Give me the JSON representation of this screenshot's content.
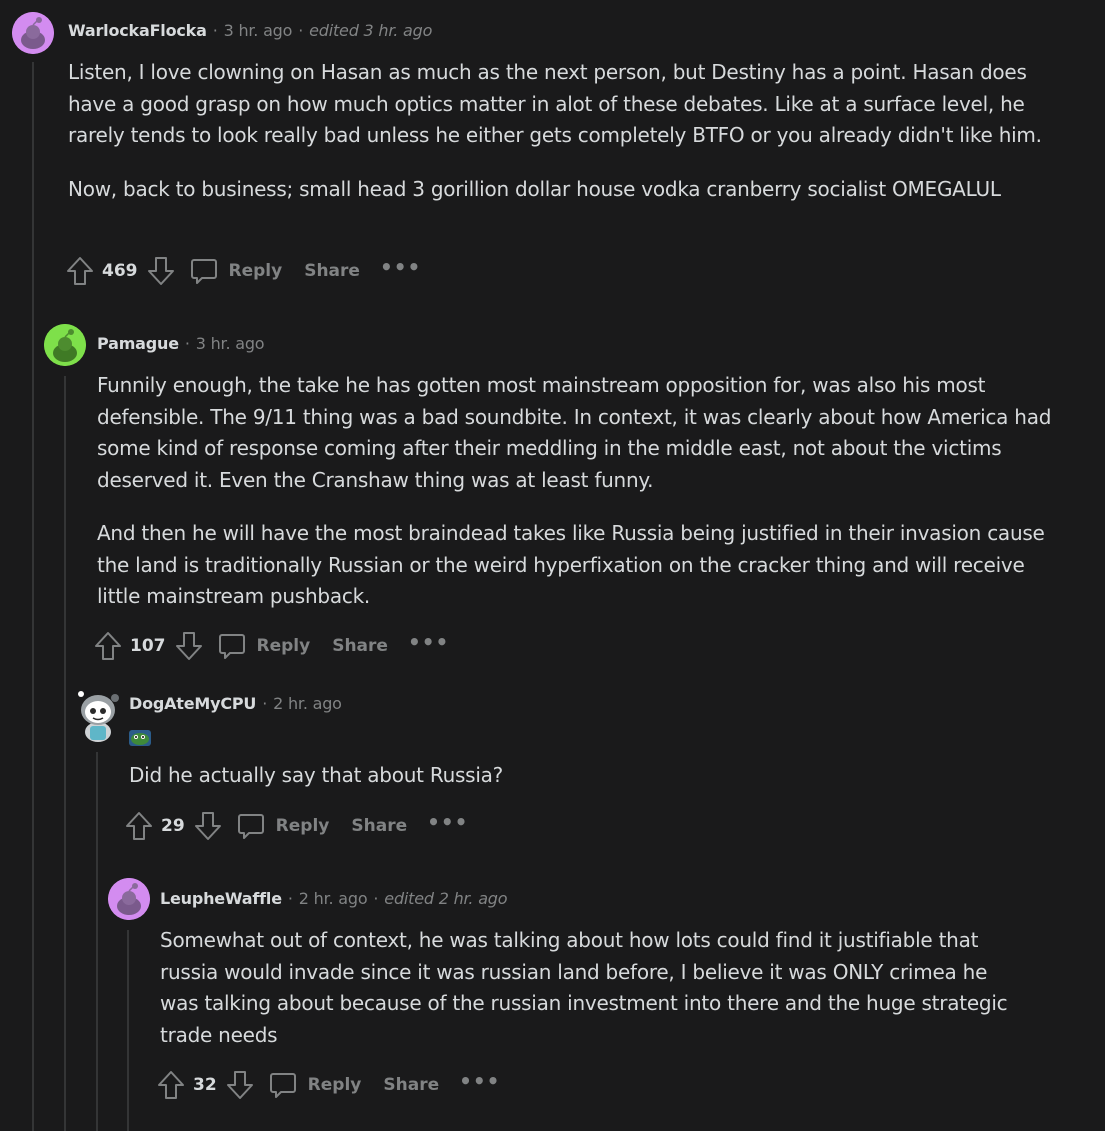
{
  "comments": [
    {
      "username": "WarlockaFlocka",
      "time": "3 hr. ago",
      "edited": "edited 3 hr. ago",
      "paragraphs": [
        "Listen, I love clowning on Hasan as much as the next person, but Destiny has a point. Hasan does have a good grasp on how much optics matter in alot of these debates. Like at a surface level, he rarely tends to look really bad unless he either gets completely BTFO or you already didn't like him.",
        "Now, back to business; small head 3 gorillion dollar house vodka cranberry socialist OMEGALUL"
      ],
      "score": "469",
      "reply_label": "Reply",
      "share_label": "Share",
      "more_label": "•••",
      "avatar_color": "#d38cf0"
    },
    {
      "username": "Pamague",
      "time": "3 hr. ago",
      "paragraphs": [
        "Funnily enough, the take he has gotten most mainstream opposition for, was also his most defensible. The 9/11 thing was a bad soundbite. In context, it was clearly about how America had some kind of response coming after their meddling in the middle east, not about the victims deserved it. Even the Cranshaw thing was at least funny.",
        "And then he will have the most braindead takes like Russia being justified in their invasion cause the land is traditionally Russian or the weird hyperfixation on the cracker thing and will receive little mainstream pushback."
      ],
      "score": "107",
      "reply_label": "Reply",
      "share_label": "Share",
      "more_label": "•••",
      "avatar_color": "#7ee04a"
    },
    {
      "username": "DogAteMyCPU",
      "time": "2 hr. ago",
      "paragraphs": [
        "Did he actually say that about Russia?"
      ],
      "score": "29",
      "reply_label": "Reply",
      "share_label": "Share",
      "more_label": "•••",
      "avatar_color": "#1a1a1b"
    },
    {
      "username": "LeupheWaffle",
      "time": "2 hr. ago",
      "edited": "edited 2 hr. ago",
      "paragraphs": [
        "Somewhat out of context, he was talking about how lots could find it justifiable that russia would invade since it was russian land before, I believe it was ONLY crimea he was talking about because of the russian investment into there and the huge strategic trade needs"
      ],
      "score": "32",
      "reply_label": "Reply",
      "share_label": "Share",
      "more_label": "•••",
      "avatar_color": "#d38cf0"
    }
  ]
}
